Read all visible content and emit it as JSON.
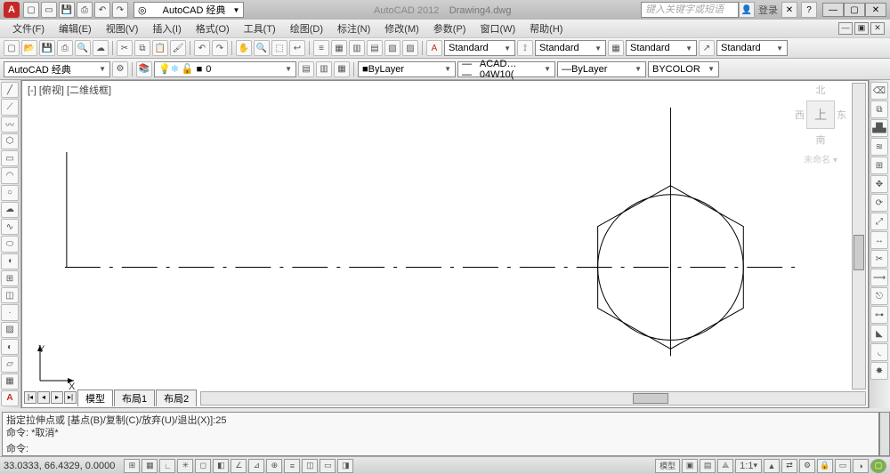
{
  "title": {
    "app": "AutoCAD 2012",
    "doc": "Drawing4.dwg"
  },
  "workspace": "AutoCAD 经典",
  "search_placeholder": "键入关键字或短语",
  "login": "登录",
  "menu": [
    "文件(F)",
    "编辑(E)",
    "视图(V)",
    "插入(I)",
    "格式(O)",
    "工具(T)",
    "绘图(D)",
    "标注(N)",
    "修改(M)",
    "参数(P)",
    "窗口(W)",
    "帮助(H)"
  ],
  "style_combos": {
    "a": "Standard",
    "b": "Standard",
    "c": "Standard",
    "d": "Standard"
  },
  "layer": {
    "current": "0",
    "linetype_layer": "ByLayer",
    "linetype": "ACAD…04W10(",
    "lineweight": "ByLayer",
    "color": "BYCOLOR"
  },
  "ws_combo": "AutoCAD 经典",
  "view_label": "[-] [俯视] [二维线框]",
  "viewcube": {
    "n": "北",
    "s": "南",
    "e": "东",
    "w": "西",
    "top": "上",
    "hint": "未命名 ▾"
  },
  "tabs": {
    "model": "模型",
    "layout1": "布局1",
    "layout2": "布局2"
  },
  "command": {
    "line1": "指定拉伸点或 [基点(B)/复制(C)/放弃(U)/退出(X)]:25",
    "line2": "命令: *取消*",
    "prompt": "命令:"
  },
  "status": {
    "coords": "33.0333,  66.4329, 0.0000",
    "space": "模型",
    "scale": "1:1",
    "ann": "▲"
  },
  "ucs": {
    "x": "X",
    "y": "Y"
  }
}
